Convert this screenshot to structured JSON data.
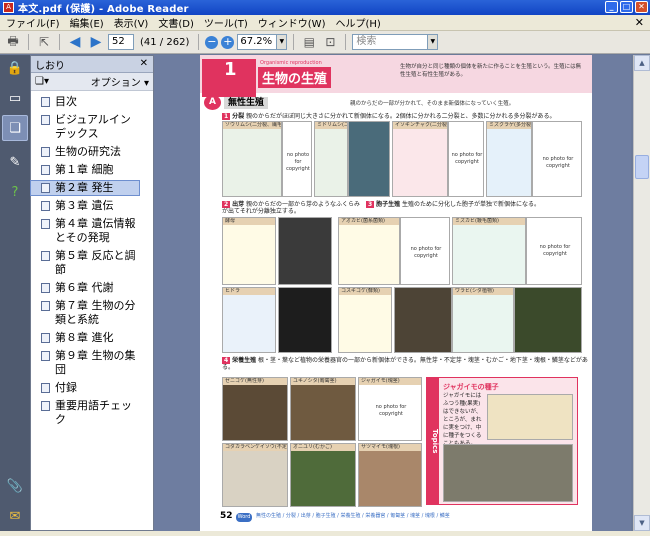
{
  "window": {
    "title": "本文.pdf (保護) - Adobe Reader"
  },
  "menu": [
    "ファイル(F)",
    "編集(E)",
    "表示(V)",
    "文書(D)",
    "ツール(T)",
    "ウィンドウ(W)",
    "ヘルプ(H)"
  ],
  "toolbar": {
    "page_value": "52",
    "page_count": "(41 / 262)",
    "zoom_value": "67.2%",
    "search_placeholder": "検索"
  },
  "bookmarks": {
    "header": "しおり",
    "options_label": "オプション ▾",
    "items": [
      {
        "label": "目次"
      },
      {
        "label": "ビジュアルインデックス"
      },
      {
        "label": "生物の研究法"
      },
      {
        "label": "第１章 細胞"
      },
      {
        "label": "第２章 発生"
      },
      {
        "label": "第３章 遺伝"
      },
      {
        "label": "第４章 遺伝情報とその発現"
      },
      {
        "label": "第５章 反応と調節"
      },
      {
        "label": "第６章 代謝"
      },
      {
        "label": "第７章 生物の分類と系統"
      },
      {
        "label": "第８章 進化"
      },
      {
        "label": "第９章 生物の集団"
      },
      {
        "label": "付録"
      },
      {
        "label": "重要用語チェック"
      }
    ],
    "selected_index": 4
  },
  "page": {
    "chapter_num": "1",
    "chapter_en": "Organismic reproduction",
    "chapter_title": "生物の生殖",
    "intro": "生物が自分と同じ種類の個体を新たに作ることを生殖という。生殖には無性生殖と有性生殖がある。",
    "section_letter": "A",
    "section_title": "無性生殖",
    "section_note": "親のからだの一部が分かれて、そのまま新個体になっていく生殖。",
    "sub1_num": "1",
    "sub1_title": "分裂",
    "sub1_text": "親のからだがほぼ同じ大きさに分かれて新個体になる。2個体に分かれる二分裂と、多数に分かれる多分裂がある。",
    "sub2_num": "2",
    "sub2_title": "出芽",
    "sub2_text": "親のからだの一部から芽のようなふくらみが出てそれが分離独立する。",
    "sub3_num": "3",
    "sub3_title": "胞子生殖",
    "sub3_text": "生殖のために分化した胞子が単独で新個体になる。",
    "sub4_num": "4",
    "sub4_title": "栄養生殖",
    "sub4_text": "根・茎・葉など植物の栄養器官の一部から新個体ができる。無性芽・不定芽・塊茎・むかご・地下茎・塊根・鱗茎などがある。",
    "no_photo": "no photo for copyright",
    "tiles_row1": [
      "ゾウリムシ(二分裂、繊毛虫)",
      "ミドリムシ(二分裂、鞭毛虫)",
      "イソギンチャク(二分裂、刺胞動物)",
      "ミズクラゲ(多分裂、刺胞動物)"
    ],
    "tiles_row2": [
      "酵母",
      "アオカビ(菌糸菌類)",
      "ミズカビ(鞭毛菌類)"
    ],
    "tiles_row3": [
      "ヒドラ",
      "コスギゴケ(蘚類)",
      "ワラビ(シダ植物)"
    ],
    "tiles_row4": [
      "ゼニゴケ(無性芽)",
      "ユキノシタ(匍匐茎)",
      "ジャガイモ(塊茎)"
    ],
    "tiles_row5": [
      "コダカラベンケイソウ(不定芽)",
      "オニユリ(むかご)",
      "サツマイモ(塊根)"
    ],
    "topics_label": "Topics",
    "topics_title": "ジャガイモの種子",
    "topics_text": "ジャガイモにはふつう種(果実)はできないが、ところが、まれに実をつけ、中に種子をつくることもある。",
    "page_number": "52",
    "word_badge": "Word",
    "footer": "無性の生殖 / 分裂 / 出芽 / 胞子生殖 / 栄養生殖 / 栄養器官 / 匍匐茎 / 塊茎 / 塊根 / 鱗茎"
  }
}
